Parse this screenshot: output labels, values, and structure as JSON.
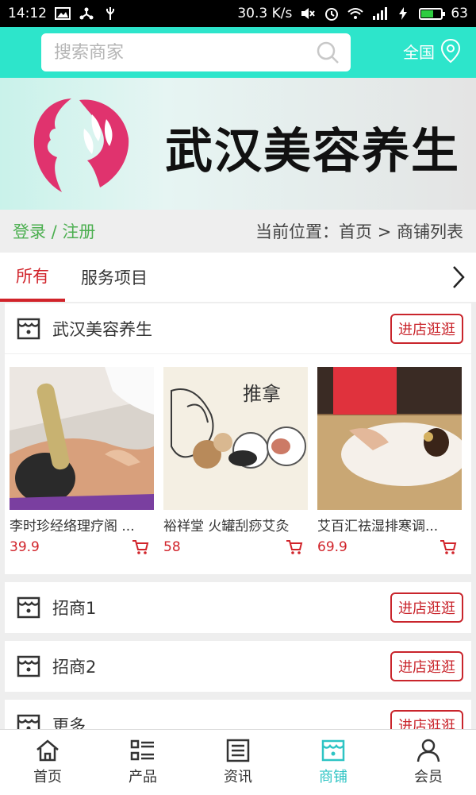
{
  "status": {
    "time": "14:12",
    "speed": "30.3 K/s",
    "battery": "63",
    "battery_fraction": 0.63
  },
  "header": {
    "search_placeholder": "搜索商家",
    "region_label": "全国"
  },
  "banner": {
    "title": "武汉美容养生"
  },
  "crumbbar": {
    "login_label": "登录 / 注册",
    "location": "当前位置：首页 > 商铺列表"
  },
  "tabs": [
    {
      "label": "所有"
    },
    {
      "label": "服务项目"
    }
  ],
  "shops": [
    {
      "name": "武汉美容养生",
      "visit_label": "进店逛逛",
      "products": [
        {
          "name": "李时珍经络理疗阁 ...",
          "price": "39.9"
        },
        {
          "name": "裕祥堂 火罐刮痧艾灸",
          "price": "58"
        },
        {
          "name": "艾百汇祛湿排寒调...",
          "price": "69.9"
        }
      ]
    },
    {
      "name": "招商1",
      "visit_label": "进店逛逛"
    },
    {
      "name": "招商2",
      "visit_label": "进店逛逛"
    },
    {
      "name": "更多",
      "visit_label": "进店逛逛"
    }
  ],
  "product_image_text": "推拿",
  "bottom_nav": [
    {
      "label": "首页",
      "icon": "home-icon"
    },
    {
      "label": "产品",
      "icon": "list-icon"
    },
    {
      "label": "资讯",
      "icon": "news-icon"
    },
    {
      "label": "商铺",
      "icon": "store-icon"
    },
    {
      "label": "会员",
      "icon": "user-icon"
    }
  ],
  "colors": {
    "header_bg": "#2de5cb",
    "accent_red": "#d1232a",
    "login_green": "#4caf50",
    "nav_active": "#2ec4c4"
  }
}
